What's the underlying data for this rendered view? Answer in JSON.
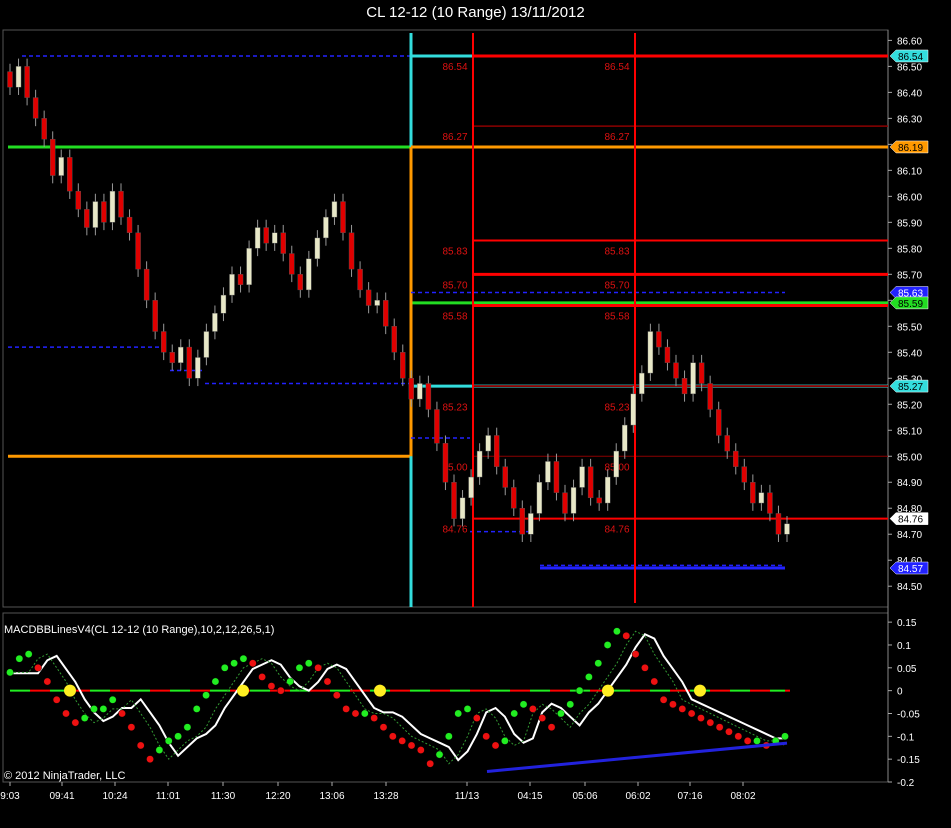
{
  "title": "CL 12-12 (10 Range)  13/11/2012",
  "copyright": "© 2012 NinjaTrader, LLC",
  "indicator_label": "MACDBBLinesV4(CL 12-12 (10 Range),10,2,12,26,5,1)",
  "colors": {
    "background": "#000000",
    "up_candle": "#e8e8c8",
    "down_candle": "#e00000",
    "level_red": "#ff0000",
    "level_darkred": "#8b0000",
    "level_green": "#22dd22",
    "level_orange": "#ff9900",
    "level_cyan": "#33dddd",
    "level_blue": "#2222ff",
    "macd_white": "#ffffff",
    "dot_green": "#22ee22",
    "dot_red": "#ee1111",
    "dot_yellow": "#ffee22",
    "divergence_blue": "#2222dd"
  },
  "chart_data": [
    {
      "type": "candlestick",
      "title": "CL 12-12 (10 Range)  13/11/2012",
      "xlabel": "",
      "ylabel": "",
      "ylim": [
        84.42,
        86.64
      ],
      "y_ticks": [
        "86.60",
        "86.50",
        "86.40",
        "86.30",
        "86.20",
        "86.10",
        "86.00",
        "85.90",
        "85.80",
        "85.70",
        "85.60",
        "85.50",
        "85.40",
        "85.30",
        "85.20",
        "85.10",
        "85.00",
        "84.90",
        "84.80",
        "84.70",
        "84.60",
        "84.50"
      ],
      "x_tick_labels": [
        "9:03",
        "09:41",
        "10:24",
        "11:01",
        "11:30",
        "12:20",
        "13:06",
        "13:28",
        "11/13",
        "04:15",
        "05:06",
        "06:02",
        "07:16",
        "08:02"
      ],
      "price_markers": [
        {
          "value": 86.54,
          "label": "86.54",
          "color": "#33dddd"
        },
        {
          "value": 86.19,
          "label": "86.19",
          "color": "#ff9900"
        },
        {
          "value": 85.63,
          "label": "85.63",
          "color": "#2222ff"
        },
        {
          "value": 85.59,
          "label": "85.59",
          "color": "#22dd22"
        },
        {
          "value": 85.27,
          "label": "85.27",
          "color": "#33dddd"
        },
        {
          "value": 84.76,
          "label": "84.76",
          "color": "#ffffff"
        },
        {
          "value": 84.57,
          "label": "84.57",
          "color": "#2222ff"
        }
      ],
      "level_labels": [
        "86.54",
        "86.27",
        "85.83",
        "85.70",
        "85.58",
        "85.23",
        "85.00",
        "84.76"
      ],
      "close_values": [
        86.42,
        86.5,
        86.38,
        86.3,
        86.22,
        86.08,
        86.15,
        86.02,
        85.95,
        85.88,
        85.98,
        85.9,
        86.02,
        85.92,
        85.86,
        85.72,
        85.6,
        85.48,
        85.4,
        85.36,
        85.42,
        85.3,
        85.38,
        85.48,
        85.55,
        85.62,
        85.7,
        85.66,
        85.8,
        85.88,
        85.82,
        85.86,
        85.78,
        85.7,
        85.64,
        85.76,
        85.84,
        85.92,
        85.98,
        85.86,
        85.72,
        85.64,
        85.58,
        85.6,
        85.5,
        85.4,
        85.3,
        85.22,
        85.28,
        85.18,
        85.05,
        84.9,
        84.76,
        84.84,
        84.92,
        85.02,
        85.08,
        84.96,
        84.88,
        84.8,
        84.7,
        84.78,
        84.9,
        84.98,
        84.86,
        84.78,
        84.88,
        84.96,
        84.84,
        84.82,
        84.92,
        85.02,
        85.12,
        85.24,
        85.32,
        85.48,
        85.42,
        85.36,
        85.3,
        85.24,
        85.36,
        85.28,
        85.18,
        85.08,
        85.02,
        84.96,
        84.9,
        84.82,
        84.86,
        84.78,
        84.7,
        84.74
      ]
    },
    {
      "type": "line",
      "title": "MACDBBLinesV4(CL 12-12 (10 Range),10,2,12,26,5,1)",
      "xlabel": "",
      "ylabel": "",
      "ylim": [
        -0.2,
        0.17
      ],
      "y_ticks": [
        "0.15",
        "0.1",
        "0.05",
        "0",
        "-0.05",
        "-0.1",
        "-0.15",
        "-0.2"
      ],
      "series": [
        {
          "values": [
            0.04,
            0.07,
            0.08,
            0.05,
            0.02,
            -0.02,
            -0.05,
            -0.07,
            -0.06,
            -0.04,
            -0.04,
            -0.02,
            -0.05,
            -0.08,
            -0.12,
            -0.15,
            -0.13,
            -0.11,
            -0.1,
            -0.08,
            -0.04,
            -0.01,
            0.02,
            0.05,
            0.06,
            0.07,
            0.06,
            0.03,
            0.01,
            0.0,
            0.02,
            0.05,
            0.06,
            0.05,
            0.02,
            -0.01,
            -0.04,
            -0.05,
            -0.05,
            -0.06,
            -0.08,
            -0.1,
            -0.11,
            -0.12,
            -0.13,
            -0.16,
            -0.14,
            -0.1,
            -0.05,
            -0.04,
            -0.06,
            -0.1,
            -0.12,
            -0.11,
            -0.05,
            -0.03,
            -0.04,
            -0.06,
            -0.08,
            -0.05,
            -0.03,
            0.0,
            0.03,
            0.06,
            0.1,
            0.13,
            0.12,
            0.08,
            0.05,
            0.02,
            -0.02,
            -0.03,
            -0.04,
            -0.05,
            -0.06,
            -0.07,
            -0.08,
            -0.09,
            -0.1,
            -0.11,
            -0.11,
            -0.12,
            -0.11,
            -0.1
          ]
        }
      ]
    }
  ]
}
